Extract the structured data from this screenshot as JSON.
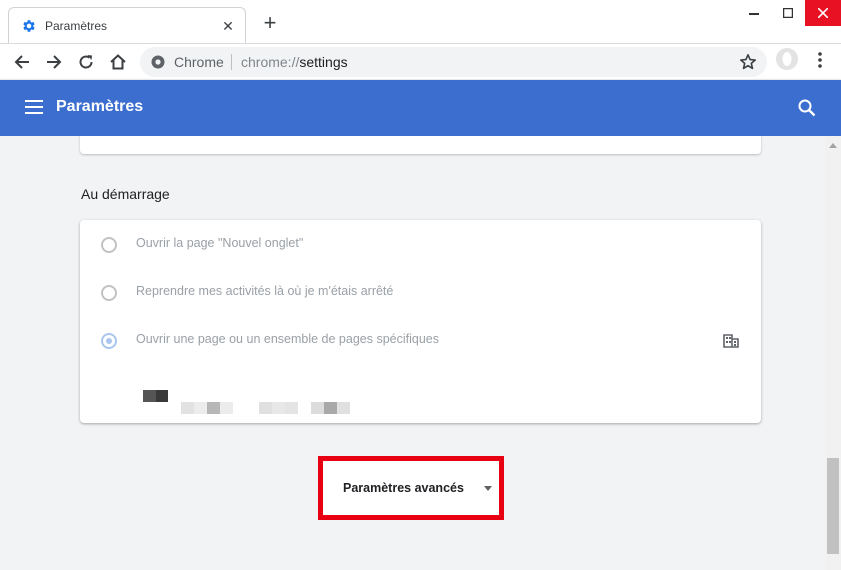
{
  "browser": {
    "tab": {
      "title": "Paramètres",
      "favicon": "gear-icon"
    },
    "new_tab_symbol": "+",
    "tab_close_symbol": "✕",
    "omnibox": {
      "chip": "Chrome",
      "url_scheme": "chrome://",
      "url_host": "settings"
    },
    "icons": [
      "back-icon",
      "forward-icon",
      "reload-icon",
      "home-icon",
      "star-icon",
      "profile-icon",
      "menu-icon"
    ]
  },
  "header": {
    "title": "Paramètres",
    "accent_color": "#3c6ed0"
  },
  "startup": {
    "section_title": "Au démarrage",
    "options": [
      {
        "label": "Ouvrir la page \"Nouvel onglet\"",
        "checked": false
      },
      {
        "label": "Reprendre mes activités là où je m'étais arrêté",
        "checked": false
      },
      {
        "label": "Ouvrir une page ou un ensemble de pages spécifiques",
        "checked": true
      }
    ]
  },
  "advanced": {
    "label": "Paramètres avancés",
    "highlight_color": "#e80012"
  }
}
